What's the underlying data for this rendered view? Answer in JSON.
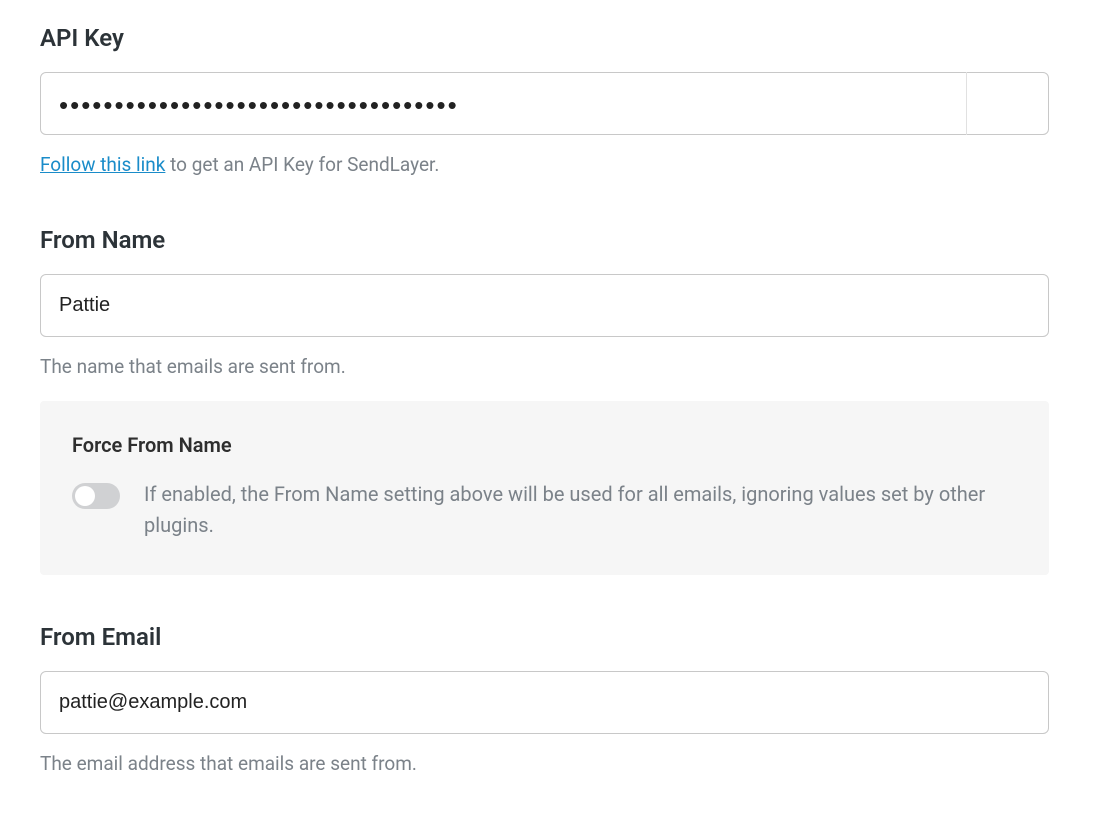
{
  "apiKey": {
    "label": "API Key",
    "value": "••••••••••••••••••••••••••••••••••••",
    "helpLink": "Follow this link",
    "helpRest": " to get an API Key for SendLayer."
  },
  "fromName": {
    "label": "From Name",
    "value": "Pattie",
    "help": "The name that emails are sent from.",
    "force": {
      "label": "Force From Name",
      "enabled": false,
      "desc": "If enabled, the From Name setting above will be used for all emails, ignoring values set by other plugins."
    }
  },
  "fromEmail": {
    "label": "From Email",
    "value": "pattie@example.com",
    "help": "The email address that emails are sent from."
  }
}
